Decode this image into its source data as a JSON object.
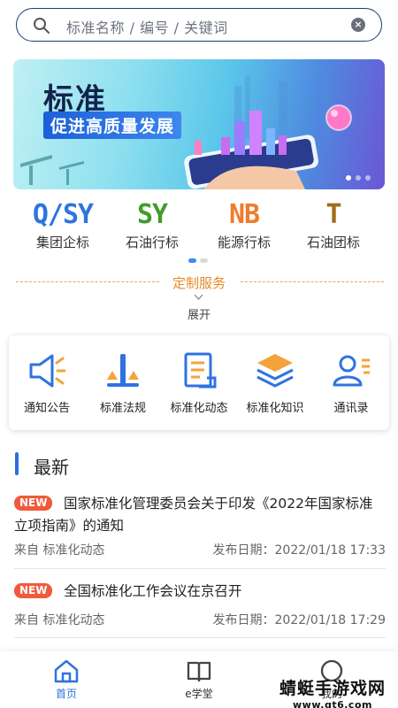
{
  "search": {
    "placeholder": "标准名称 / 编号 / 关键词"
  },
  "banner": {
    "title": "标准",
    "subtitle": "促进高质量发展"
  },
  "categories": [
    {
      "code": "Q/SY",
      "name": "集团企标",
      "color": "#2f74de"
    },
    {
      "code": "SY",
      "name": "石油行标",
      "color": "#3f9d2c"
    },
    {
      "code": "NB",
      "name": "能源行标",
      "color": "#ef7c2b"
    },
    {
      "code": "T",
      "name": "石油团标",
      "color": "#a26a19"
    }
  ],
  "custom_service": {
    "title": "定制服务",
    "expand": "展开"
  },
  "tools": [
    {
      "label": "通知公告",
      "icon": "megaphone-icon"
    },
    {
      "label": "标准法规",
      "icon": "scale-icon"
    },
    {
      "label": "标准化动态",
      "icon": "document-icon"
    },
    {
      "label": "标准化知识",
      "icon": "layers-icon"
    },
    {
      "label": "通讯录",
      "icon": "contacts-icon"
    }
  ],
  "latest": {
    "title": "最新",
    "items": [
      {
        "badge": "NEW",
        "title": "国家标准化管理委员会关于印发《2022年国家标准立项指南》的通知",
        "source": "来自  标准化动态",
        "date": "发布日期：2022/01/18 17:33"
      },
      {
        "badge": "NEW",
        "title": "全国标准化工作会议在京召开",
        "source": "来自  标准化动态",
        "date": "发布日期：2022/01/18 17:29"
      }
    ]
  },
  "bottom_nav": [
    {
      "label": "首页",
      "active": true
    },
    {
      "label": "e学堂",
      "active": false
    },
    {
      "label": "我的",
      "active": false
    }
  ],
  "watermark": {
    "line1": "蜻蜓手游戏网",
    "line2": "www.qt6.com"
  },
  "colors": {
    "accent": "#2f73e0",
    "badge": "#f05a3c",
    "service": "#e78a25"
  }
}
